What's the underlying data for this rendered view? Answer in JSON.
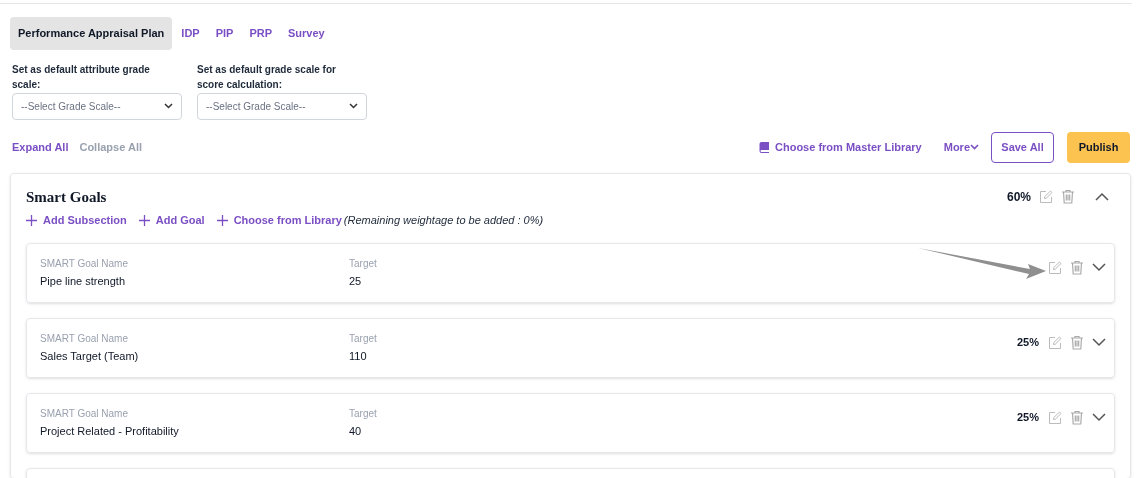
{
  "tabs": [
    {
      "label": "Performance Appraisal Plan",
      "selected": true
    },
    {
      "label": "IDP",
      "selected": false
    },
    {
      "label": "PIP",
      "selected": false
    },
    {
      "label": "PRP",
      "selected": false
    },
    {
      "label": "Survey",
      "selected": false
    }
  ],
  "grade_scales": [
    {
      "label": "Set as default attribute grade scale:",
      "placeholder": "--Select Grade Scale--"
    },
    {
      "label": "Set as default grade scale for score calculation:",
      "placeholder": "--Select Grade Scale--"
    }
  ],
  "expand_all": "Expand All",
  "collapse_all": "Collapse All",
  "choose_master_library": "Choose from Master Library",
  "more": "More",
  "save_all": "Save All",
  "publish": "Publish",
  "section": {
    "title": "Smart Goals",
    "weight": "60%",
    "expanded": true,
    "actions": [
      "Add Subsection",
      "Add Goal",
      "Choose from Library"
    ],
    "note": "(Remaining weightage to be added : 0%)",
    "goals": [
      {
        "name_label": "SMART Goal Name",
        "name": "Pipe line strength",
        "target_label": "Target",
        "target": "25",
        "expanded": false
      },
      {
        "name_label": "SMART Goal Name",
        "name": "Sales Target (Team)",
        "target_label": "Target",
        "target": "110",
        "weight": "25%",
        "expanded": false
      },
      {
        "name_label": "SMART Goal Name",
        "name": "Project Related - Profitability",
        "target_label": "Target",
        "target": "40",
        "weight": "25%",
        "expanded": false
      }
    ]
  }
}
